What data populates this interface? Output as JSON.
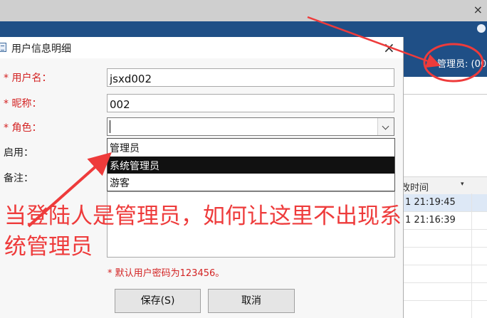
{
  "background": {
    "close_glyph": "×",
    "user_label": "管理员: (00",
    "table": {
      "column_header": "改时间",
      "sort_glyph": "▾",
      "rows": [
        "1 21:19:45",
        "1 21:16:39"
      ]
    }
  },
  "dialog": {
    "title": "用户信息明细",
    "close_glyph": "×",
    "fields": {
      "username": {
        "label": "* 用户名：",
        "value": "jsxd002"
      },
      "nickname": {
        "label": "* 昵称：",
        "value": "002"
      },
      "role": {
        "label": "* 角色：",
        "value": "",
        "options": [
          "管理员",
          "系统管理员",
          "游客"
        ],
        "highlighted_option": "系统管理员"
      },
      "enabled": {
        "label": "启用："
      },
      "remarks": {
        "label": "备注："
      }
    },
    "password_hint": "* 默认用户密码为123456。",
    "buttons": {
      "save": "保存(S)",
      "cancel": "取消"
    }
  },
  "annotation": {
    "text": "当登陆人是管理员，如何让这里不出现系统管理员",
    "color": "#ee3b3b"
  }
}
